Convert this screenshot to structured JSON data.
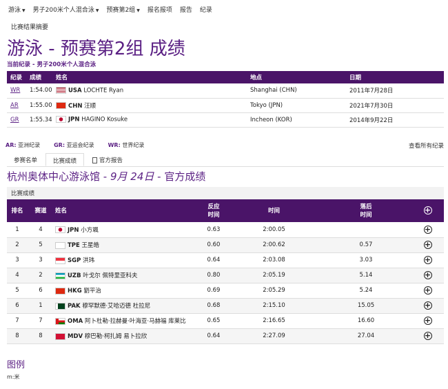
{
  "topnav": [
    {
      "label": "游泳",
      "caret": true
    },
    {
      "label": "男子200米个人混合泳",
      "caret": true
    },
    {
      "label": "预赛第2组",
      "caret": true
    },
    {
      "label": "报名报项",
      "caret": false
    },
    {
      "label": "报告",
      "caret": false
    },
    {
      "label": "纪录",
      "caret": false
    }
  ],
  "subnav": "比赛结果摘要",
  "page_title": "游泳 - 预赛第2组 成绩",
  "current_record_label": "当前纪录 - 男子200米个人混合泳",
  "records": {
    "headers": [
      "纪录",
      "成绩",
      "姓名",
      "地点",
      "日期"
    ],
    "rows": [
      {
        "code": "WR",
        "time": "1:54.00",
        "noc": "USA",
        "name": "LOCHTE Ryan",
        "place": "Shanghai (CHN)",
        "date": "2011年7月28日"
      },
      {
        "code": "AR",
        "time": "1:55.00",
        "noc": "CHN",
        "name": "汪顺",
        "place": "Tokyo (JPN)",
        "date": "2021年7月30日"
      },
      {
        "code": "GR",
        "time": "1:55.34",
        "noc": "JPN",
        "name": "HAGINO Kosuke",
        "place": "Incheon (KOR)",
        "date": "2014年9月22日"
      }
    ]
  },
  "legend_line": [
    {
      "abbr": "AR:",
      "text": "亚洲纪录"
    },
    {
      "abbr": "GR:",
      "text": "亚运会纪录"
    },
    {
      "abbr": "WR:",
      "text": "世界纪录"
    }
  ],
  "view_all": "查看所有纪录",
  "tabs": [
    "参赛名单",
    "比赛成绩",
    "官方报告"
  ],
  "venue": {
    "name": "杭州奥体中心游泳馆",
    "date": "9月 24日",
    "suffix": "官方成绩",
    "sep": " - "
  },
  "results_label": "比赛成绩",
  "results": {
    "headers": {
      "rank": "排名",
      "lane": "赛道",
      "name": "姓名",
      "reaction_1": "反应",
      "reaction_2": "时间",
      "time": "时间",
      "behind_1": "落后",
      "behind_2": "时间"
    },
    "rows": [
      {
        "rank": "1",
        "lane": "4",
        "noc": "JPN",
        "name": "小方颯",
        "reaction": "0.63",
        "time": "2:00.05",
        "behind": ""
      },
      {
        "rank": "2",
        "lane": "5",
        "noc": "TPE",
        "name": "王星皓",
        "reaction": "0.60",
        "time": "2:00.62",
        "behind": "0.57"
      },
      {
        "rank": "3",
        "lane": "3",
        "noc": "SGP",
        "name": "洪玮",
        "reaction": "0.64",
        "time": "2:03.08",
        "behind": "3.03"
      },
      {
        "rank": "4",
        "lane": "2",
        "noc": "UZB",
        "name": "叶戈尔 佩特里亚科夫",
        "reaction": "0.80",
        "time": "2:05.19",
        "behind": "5.14"
      },
      {
        "rank": "5",
        "lane": "6",
        "noc": "HKG",
        "name": "劉平治",
        "reaction": "0.69",
        "time": "2:05.29",
        "behind": "5.24"
      },
      {
        "rank": "6",
        "lane": "1",
        "noc": "PAK",
        "name": "穆罕默德·艾哈迈德 杜拉尼",
        "reaction": "0.68",
        "time": "2:15.10",
        "behind": "15.05"
      },
      {
        "rank": "7",
        "lane": "7",
        "noc": "OMA",
        "name": "阿卜杜勒·拉赫曼·叶海亚·马赫福 库莱比",
        "reaction": "0.65",
        "time": "2:16.65",
        "behind": "16.60"
      },
      {
        "rank": "8",
        "lane": "8",
        "noc": "MDV",
        "name": "穆巴勒·柯扎姆 易卜拉欣",
        "reaction": "0.64",
        "time": "2:27.09",
        "behind": "27.04"
      }
    ]
  },
  "legend_title": "图例",
  "legend_item": "m:米",
  "colors": {
    "brand": "#5a1f83",
    "header_bg": "#4a1468"
  }
}
